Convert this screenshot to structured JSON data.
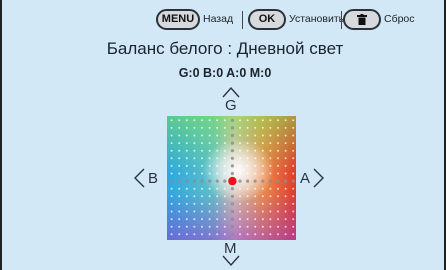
{
  "hints": {
    "menu_key": "MENU",
    "menu_label": "Назад",
    "ok_key": "OK",
    "ok_label": "Установить",
    "trash_icon": "trash-icon",
    "reset_label": "Сброс"
  },
  "title": "Баланс белого : Дневной свет",
  "values": "G:0 B:0 A:0 M:0",
  "axes": {
    "top": "G",
    "bottom": "M",
    "left": "B",
    "right": "A"
  },
  "grid": {
    "ga_shift": 0,
    "ab_shift": 0,
    "cursor_color": "#e8141c",
    "colors": {
      "blue": "#2ba7e0",
      "amber": "#e03a2a",
      "green": "#82e650",
      "magenta": "#963cd2"
    }
  }
}
